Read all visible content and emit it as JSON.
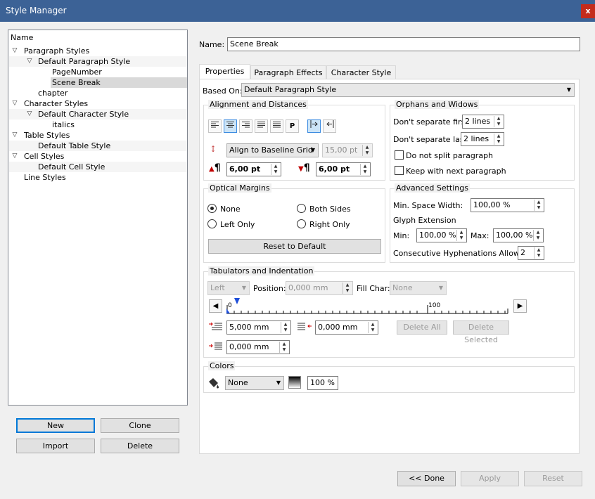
{
  "window": {
    "title": "Style Manager",
    "close": "x"
  },
  "tree": {
    "header": "Name",
    "items": [
      {
        "label": "Paragraph Styles"
      },
      {
        "label": "Default Paragraph Style"
      },
      {
        "label": "PageNumber"
      },
      {
        "label": "Scene Break",
        "selected": true
      },
      {
        "label": "chapter"
      },
      {
        "label": "Character Styles"
      },
      {
        "label": "Default Character Style"
      },
      {
        "label": "italics"
      },
      {
        "label": "Table Styles"
      },
      {
        "label": "Default Table Style"
      },
      {
        "label": "Cell Styles"
      },
      {
        "label": "Default Cell Style"
      },
      {
        "label": "Line Styles"
      }
    ]
  },
  "left_buttons": {
    "new": "New",
    "clone": "Clone",
    "import": "Import",
    "delete": "Delete"
  },
  "name": {
    "label": "Name:",
    "value": "Scene Break"
  },
  "tabs": [
    "Properties",
    "Paragraph Effects",
    "Character Style"
  ],
  "based_on": {
    "label": "Based On:",
    "value": "Default Paragraph Style"
  },
  "alignment": {
    "title": "Alignment and Distances",
    "p_label": "P",
    "line_spacing_mode": "Align to Baseline Grid",
    "line_spacing_value": "15,00 pt",
    "space_above": "6,00 pt",
    "space_below": "6,00 pt"
  },
  "orphans": {
    "title": "Orphans and Widows",
    "first_label": "Don't separate first",
    "first_value": "2 lines",
    "last_label": "Don't separate last",
    "last_value": "2 lines",
    "no_split": "Do not split paragraph",
    "keep_next": "Keep with next paragraph"
  },
  "optical": {
    "title": "Optical Margins",
    "none": "None",
    "both": "Both Sides",
    "left": "Left Only",
    "right": "Right Only",
    "reset": "Reset to Default"
  },
  "advanced": {
    "title": "Advanced Settings",
    "min_space_label": "Min. Space Width:",
    "min_space_value": "100,00 %",
    "glyph_label": "Glyph Extension",
    "min_label": "Min:",
    "min_value": "100,00 %",
    "max_label": "Max:",
    "max_value": "100,00 %",
    "hyph_label": "Consecutive Hyphenations Allowed:",
    "hyph_value": "2"
  },
  "tabulators": {
    "title": "Tabulators and Indentation",
    "type": "Left",
    "position_label": "Position:",
    "position_value": "0,000 mm",
    "fill_label": "Fill Char:",
    "fill_value": "None",
    "ruler_start": "0",
    "ruler_mid": "100",
    "first_indent": "5,000 mm",
    "right_indent": "0,000 mm",
    "left_indent": "0,000 mm",
    "delete_all": "Delete All",
    "delete_selected": "Delete Selected"
  },
  "colors": {
    "title": "Colors",
    "fill": "None",
    "shade": "100 %"
  },
  "bottom": {
    "done": "<< Done",
    "apply": "Apply",
    "reset": "Reset"
  },
  "accent": "#3c6296"
}
